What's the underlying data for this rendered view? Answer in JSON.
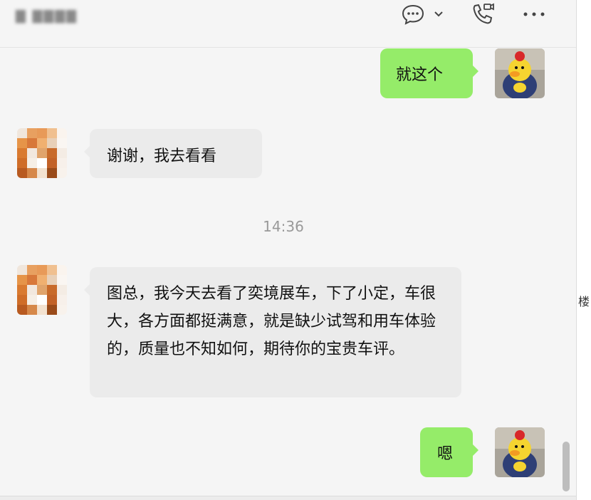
{
  "header": {
    "contact_name": "▇ ▇▇▇▇",
    "icons": [
      "chat-bubble-icon",
      "chevron-down-icon",
      "video-call-icon",
      "more-icon"
    ]
  },
  "messages": [
    {
      "side": "out",
      "text": "就这个"
    },
    {
      "side": "in",
      "text": "谢谢，我去看看"
    },
    {
      "side": "in",
      "text": "图总，我今天去看了奕境展车，下了小定，车很大，各方面都挺满意，就是缺少试驾和用车体验的，质量也不知如何，期待你的宝贵车评。"
    },
    {
      "side": "out",
      "text": "嗯"
    }
  ],
  "timestamp": "14:36",
  "gutter_text": "楼",
  "colors": {
    "outgoing_bubble": "#95ec69",
    "incoming_bubble": "#ebebeb",
    "background": "#f5f5f5"
  }
}
